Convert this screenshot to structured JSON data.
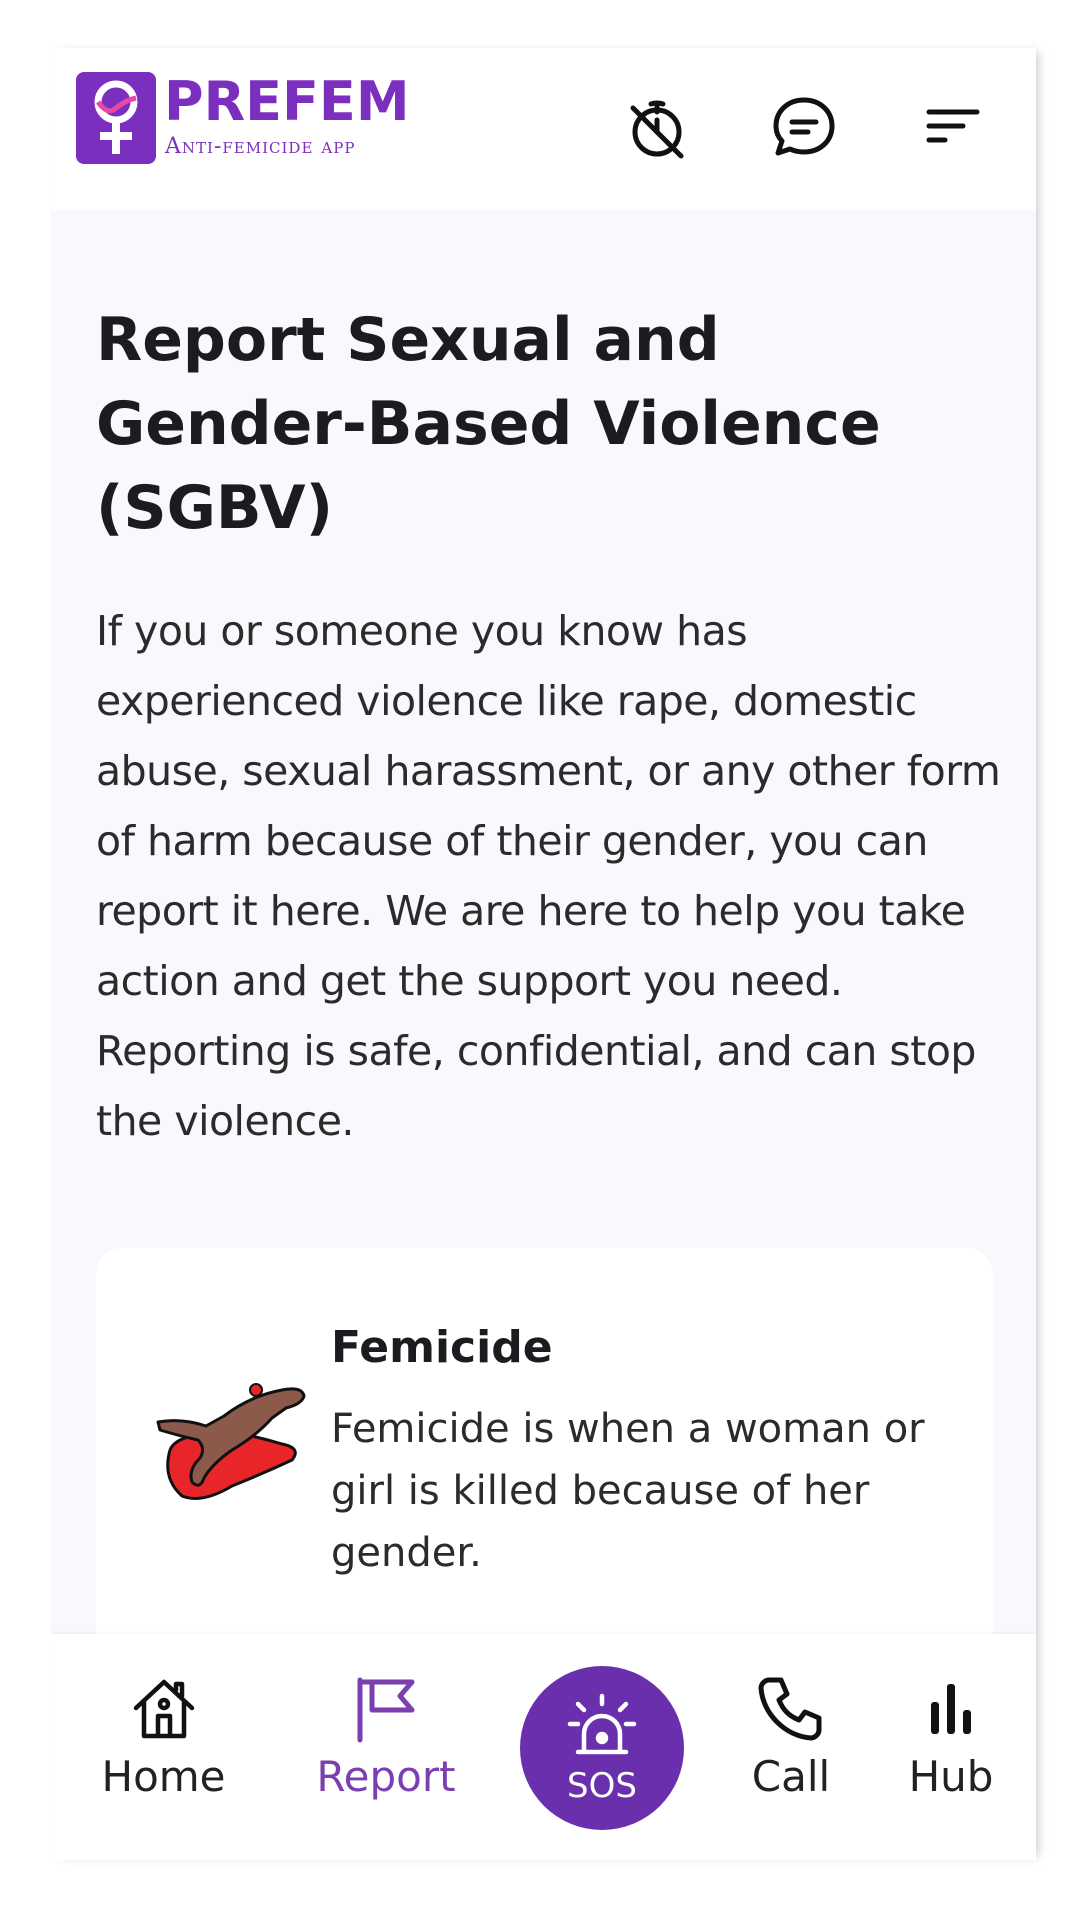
{
  "app": {
    "name": "PREFEM",
    "tagline": "Anti-femicide app",
    "brand_color": "#7b2fbf"
  },
  "header": {
    "icons": [
      "timer-off-icon",
      "chat-icon",
      "menu-icon"
    ]
  },
  "main": {
    "title": "Report Sexual and Gender-Based Violence (SGBV)",
    "intro": "If you or someone you know has experienced violence like rape, domestic abuse, sexual harassment, or any other form of harm because of their gender, you can report it here. We are here to help you take action and get the support you need. Reporting is safe, confidential, and can stop the violence."
  },
  "cards": [
    {
      "title": "Femicide",
      "description": "Femicide is when a woman or girl is killed because of her gender.",
      "icon": "femicide-illustration"
    }
  ],
  "bottom_nav": {
    "home": "Home",
    "report": "Report",
    "sos": "SOS",
    "call": "Call",
    "hub": "Hub",
    "active": "report",
    "active_color": "#7b3fb0",
    "sos_color": "#6a2fad"
  }
}
